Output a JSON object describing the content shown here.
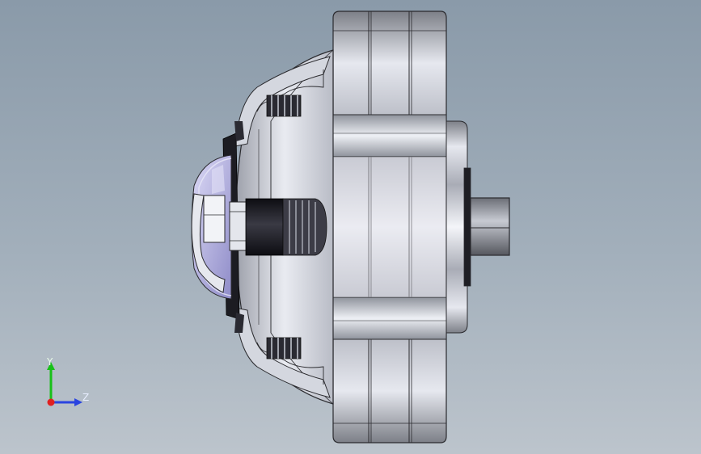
{
  "viewport": {
    "background_top": "#8a9aa9",
    "background_bottom": "#bcc4cc"
  },
  "model": {
    "body_color": "#c9ccd6",
    "edge_color": "#2a2a2e",
    "dark_part_color": "#1c1c22",
    "lens_color": "#b7b5e6"
  },
  "triad": {
    "y_label": "Y",
    "z_label": "Z",
    "y_color": "#18c018",
    "z_color": "#2a44e0",
    "x_color": "#e02020"
  }
}
